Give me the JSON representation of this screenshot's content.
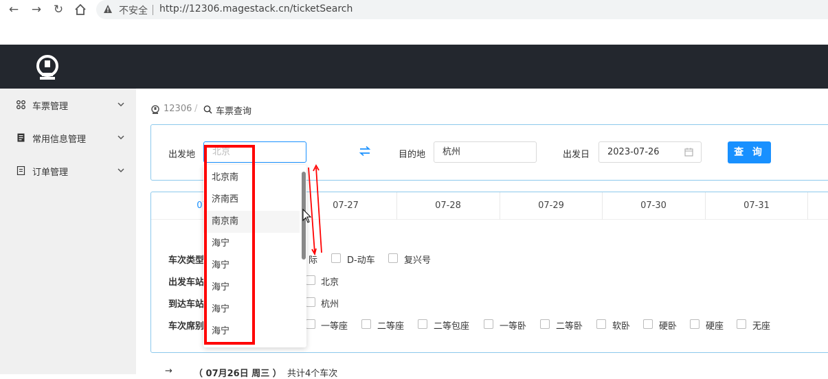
{
  "browser": {
    "security_label": "不安全",
    "url": "http://12306.magestack.cn/ticketSearch"
  },
  "sidebar": {
    "items": [
      {
        "label": "车票管理",
        "icon": "grid-icon"
      },
      {
        "label": "常用信息管理",
        "icon": "document-icon"
      },
      {
        "label": "订单管理",
        "icon": "list-icon"
      }
    ]
  },
  "breadcrumb": {
    "home": "12306",
    "separator": "/",
    "current": "车票查询"
  },
  "search": {
    "from_label": "出发地",
    "from_placeholder": "北京",
    "to_label": "目的地",
    "to_value": "杭州",
    "date_label": "出发日",
    "date_value": "2023-07-26",
    "query_button": "查 询"
  },
  "date_tabs": [
    "07",
    "07-27",
    "07-28",
    "07-29",
    "07-30",
    "07-31"
  ],
  "filters": {
    "train_type_label": "车次类型",
    "train_types": [
      "际",
      "D-动车",
      "复兴号"
    ],
    "depart_station_label": "出发车站",
    "depart_station": "北京",
    "arrive_station_label": "到达车站",
    "arrive_station": "杭州",
    "seat_label": "车次席别",
    "seats": [
      "一等座",
      "二等座",
      "二等包座",
      "一等卧",
      "二等卧",
      "软卧",
      "硬卧",
      "硬座",
      "无座"
    ]
  },
  "summary": {
    "arrow": "→",
    "date_text": "（ 07月26日  周三 ）",
    "count_text": "共计4个车次"
  },
  "dropdown": {
    "options": [
      "北京南",
      "济南西",
      "南京南",
      "海宁",
      "海宁",
      "海宁",
      "海宁",
      "海宁"
    ],
    "hover_index": 2
  },
  "colors": {
    "header_bg": "#23272e",
    "accent": "#1890ff",
    "annotation": "#ff0000"
  }
}
